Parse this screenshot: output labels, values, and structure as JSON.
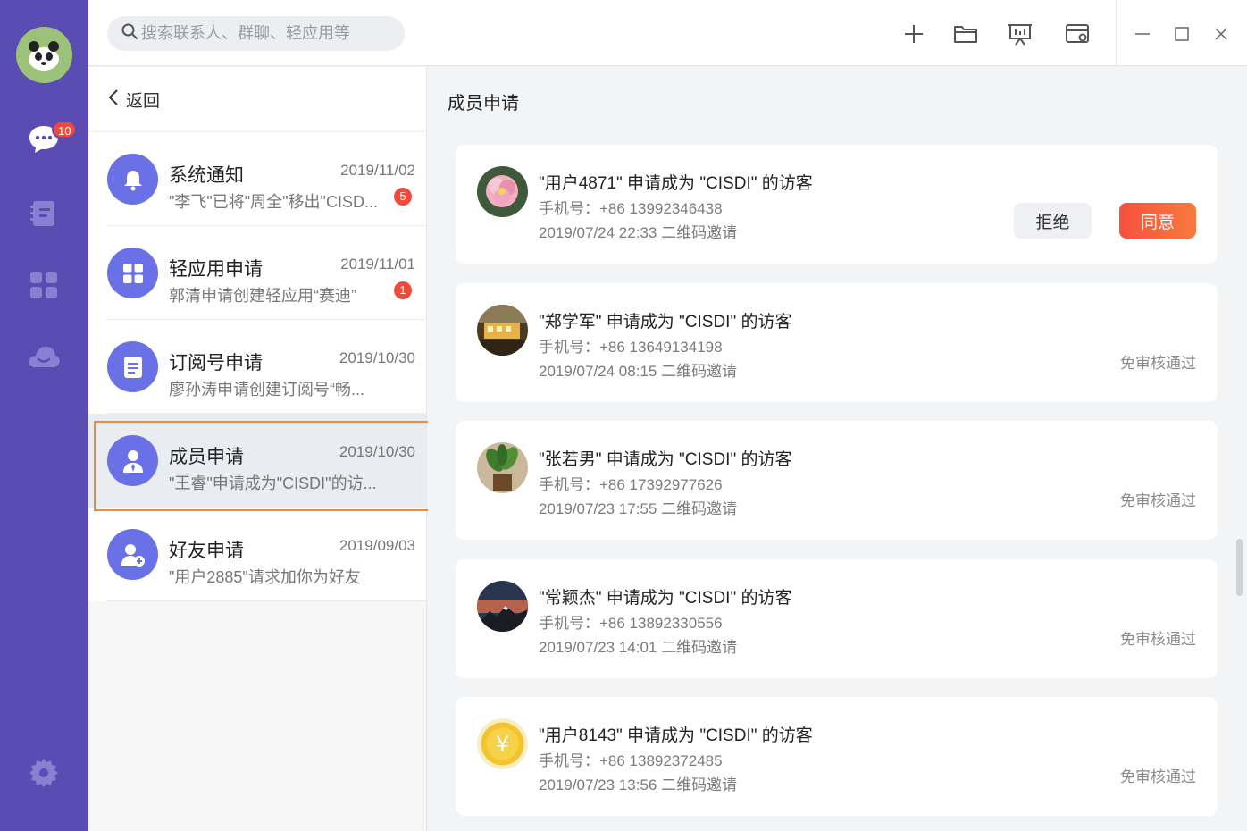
{
  "app": {
    "chat_badge": "10"
  },
  "search": {
    "placeholder": "搜索联系人、群聊、轻应用等"
  },
  "list": {
    "back_label": "返回",
    "items": [
      {
        "title": "系统通知",
        "date": "2019/11/02",
        "subtitle": "\"李飞\"已将\"周全\"移出\"CISD...",
        "count": "5",
        "icon": "bell-icon"
      },
      {
        "title": "轻应用申请",
        "date": "2019/11/01",
        "subtitle": "郭清申请创建轻应用“赛迪”",
        "count": "1",
        "icon": "grid-icon"
      },
      {
        "title": "订阅号申请",
        "date": "2019/10/30",
        "subtitle": "廖孙涛申请创建订阅号“畅...",
        "count": "",
        "icon": "document-icon"
      },
      {
        "title": "成员申请",
        "date": "2019/10/30",
        "subtitle": "\"王睿\"申请成为\"CISDI\"的访...",
        "count": "",
        "icon": "member-icon"
      },
      {
        "title": "好友申请",
        "date": "2019/09/03",
        "subtitle": "\"用户2885\"请求加你为好友",
        "count": "",
        "icon": "add-friend-icon"
      }
    ]
  },
  "detail": {
    "title": "成员申请",
    "reject_label": "拒绝",
    "agree_label": "同意",
    "requests": [
      {
        "name": "\"用户4871\" 申请成为 \"CISDI\" 的访客",
        "phone": "手机号：+86 13992346438",
        "time": "2019/07/24 22:33 二维码邀请",
        "status": ""
      },
      {
        "name": "\"郑学军\" 申请成为 \"CISDI\" 的访客",
        "phone": "手机号：+86 13649134198",
        "time": "2019/07/24 08:15 二维码邀请",
        "status": "免审核通过"
      },
      {
        "name": "\"张若男\" 申请成为 \"CISDI\" 的访客",
        "phone": "手机号：+86 17392977626",
        "time": "2019/07/23 17:55 二维码邀请",
        "status": "免审核通过"
      },
      {
        "name": "\"常颖杰\" 申请成为 \"CISDI\" 的访客",
        "phone": "手机号：+86 13892330556",
        "time": "2019/07/23 14:01 二维码邀请",
        "status": "免审核通过"
      },
      {
        "name": "\"用户8143\" 申请成为 \"CISDI\" 的访客",
        "phone": "手机号：+86 13892372485",
        "time": "2019/07/23 13:56 二维码邀请",
        "status": "免审核通过"
      }
    ]
  },
  "colors": {
    "rail": "#5b4cb3",
    "accent": "#6a70e6",
    "badge": "#f04a3a",
    "agree": "#f6503e",
    "selection_border": "#f08a3a"
  }
}
